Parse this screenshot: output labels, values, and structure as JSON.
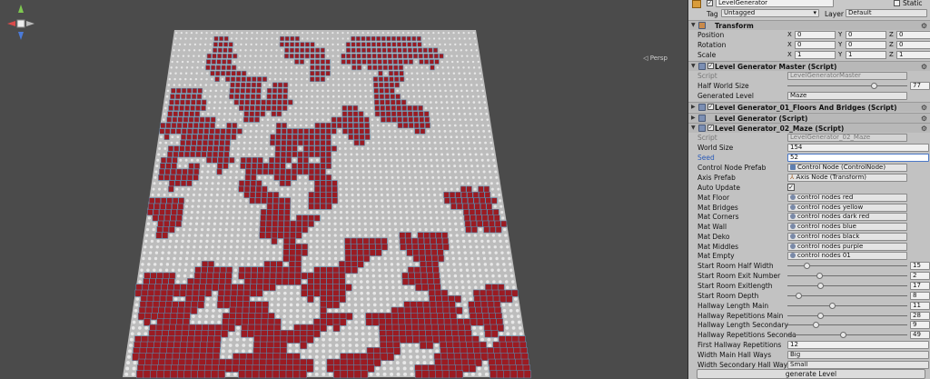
{
  "scene": {
    "view_label": "Persp"
  },
  "header": {
    "object_name": "LevelGenerator",
    "static_label": "Static",
    "tag_label": "Tag",
    "tag_value": "Untagged",
    "layer_label": "Layer",
    "layer_value": "Default"
  },
  "transform": {
    "title": "Transform",
    "rows": [
      {
        "label": "Position",
        "x": "0",
        "y": "0",
        "z": "0"
      },
      {
        "label": "Rotation",
        "x": "0",
        "y": "0",
        "z": "0"
      },
      {
        "label": "Scale",
        "x": "1",
        "y": "1",
        "z": "1"
      }
    ]
  },
  "master": {
    "title": "Level Generator Master (Script)",
    "script_label": "Script",
    "script_value": "LevelGeneratorMaster",
    "half_world_label": "Half World Size",
    "half_world_value": "77",
    "half_world_fraction": 0.72,
    "generated_label": "Generated Level",
    "generated_value": "Maze"
  },
  "collapsed": {
    "floors_title": "Level Generator_01_Floors And Bridges (Script)",
    "lg_title": "Level Generator (Script)"
  },
  "maze": {
    "title": "Level Generator_02_Maze (Script)",
    "script_label": "Script",
    "script_value": "LevelGenerator_02_Maze",
    "world_size_label": "World Size",
    "world_size_value": "154",
    "seed_label": "Seed",
    "seed_value": "52",
    "control_prefab_label": "Control Node Prefab",
    "control_prefab_value": "Control Node (ControlNode)",
    "axis_prefab_label": "Axis Prefab",
    "axis_prefab_value": "Axis Node (Transform)",
    "auto_update_label": "Auto Update",
    "materials": [
      {
        "label": "Mat Floor",
        "value": "control nodes red"
      },
      {
        "label": "Mat Bridges",
        "value": "control nodes yellow"
      },
      {
        "label": "Mat Corners",
        "value": "control nodes dark red"
      },
      {
        "label": "Mat Wall",
        "value": "control nodes blue"
      },
      {
        "label": "Mat Deko",
        "value": "control nodes black"
      },
      {
        "label": "Mat Middles",
        "value": "control nodes purple"
      },
      {
        "label": "Mat Empty",
        "value": "control nodes 01"
      }
    ],
    "sliders": [
      {
        "label": "Start Room Half Width",
        "value": "15",
        "fraction": 0.14
      },
      {
        "label": "Start Room Exit Number",
        "value": "2",
        "fraction": 0.25
      },
      {
        "label": "Start Room Exitlength",
        "value": "17",
        "fraction": 0.26
      },
      {
        "label": "Start Room Depth",
        "value": "8",
        "fraction": 0.07
      },
      {
        "label": "Hallway Length Main",
        "value": "11",
        "fraction": 0.36
      },
      {
        "label": "Hallway Repetitions Main",
        "value": "28",
        "fraction": 0.26
      },
      {
        "label": "Hallway Length Secondary",
        "value": "9",
        "fraction": 0.22
      },
      {
        "label": "Hallway Repetitions Seconda",
        "value": "49",
        "fraction": 0.45
      }
    ],
    "first_hallway_label": "First Hallway Repetitions",
    "first_hallway_value": "12",
    "width_main_label": "Width Main Hall Ways",
    "width_main_value": "Big",
    "width_secondary_label": "Width Secondary Hall Ways",
    "width_secondary_value": "Small",
    "generate_button": "generate Level"
  },
  "colors": {
    "maze_red": "#9b1b22",
    "wall_blue": "#5a86a8",
    "node_white": "#e8e8e8",
    "scene_bg": "#4b4b4b",
    "inspector_bg": "#c2c2c2"
  }
}
